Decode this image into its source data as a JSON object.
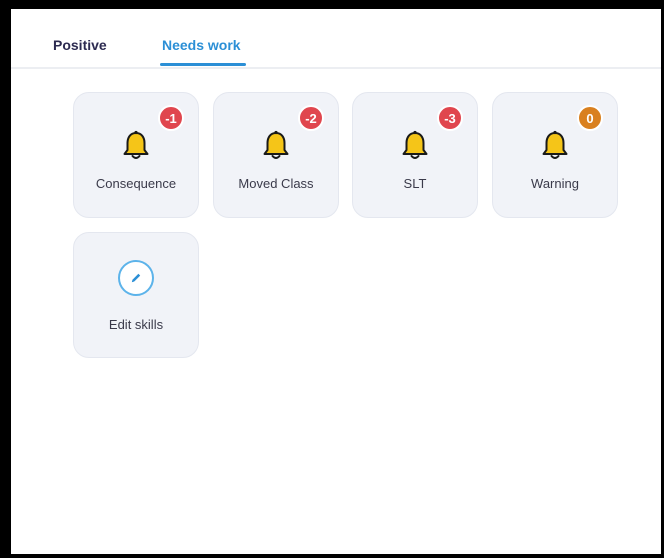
{
  "tabs": {
    "positive": "Positive",
    "needs_work": "Needs work",
    "active": "needs_work",
    "active_color": "#2b8fd6"
  },
  "skills": [
    {
      "label": "Consequence",
      "points": "-1",
      "badge_color": "#e0464e",
      "icon": "bell-icon"
    },
    {
      "label": "Moved Class",
      "points": "-2",
      "badge_color": "#e0464e",
      "icon": "bell-icon"
    },
    {
      "label": "SLT",
      "points": "-3",
      "badge_color": "#e0464e",
      "icon": "bell-icon"
    },
    {
      "label": "Warning",
      "points": "0",
      "badge_color": "#d9801f",
      "icon": "bell-icon"
    }
  ],
  "edit": {
    "label": "Edit skills",
    "icon": "pencil-icon"
  }
}
